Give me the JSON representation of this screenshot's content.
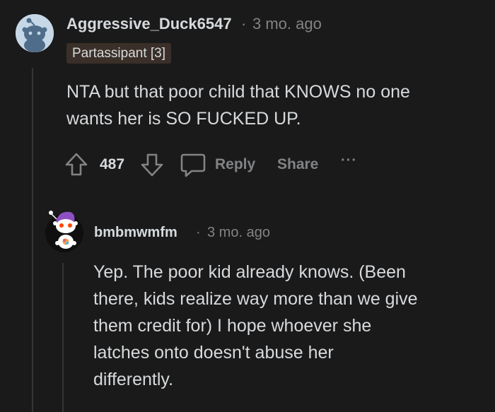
{
  "comment": {
    "username": "Aggressive_Duck6547",
    "separator": "·",
    "timestamp": "3 mo. ago",
    "flair": "Partassipant [3]",
    "body_lines": [
      "NTA but that poor child that KNOWS no one",
      "wants her is SO FUCKED UP."
    ],
    "votes": "487",
    "reply_label": "Reply",
    "share_label": "Share",
    "more_label": "···",
    "icons": [
      "upvote-arrow-icon",
      "downvote-arrow-icon",
      "comment-bubble-icon",
      "more-options-icon"
    ],
    "accent_color": "#818384"
  },
  "reply": {
    "username": "bmbmwmfm",
    "separator": "·",
    "timestamp": "3 mo. ago",
    "body_lines": [
      "Yep. The poor kid already knows. (Been",
      "there, kids realize way more than we give",
      "them credit for) I hope whoever she",
      "latches onto doesn't abuse her",
      "differently."
    ]
  },
  "colors": {
    "background": "#1a1a1b",
    "text": "#d7dadc",
    "muted": "#818384",
    "flair_bg": "#3a2f29",
    "thread_line": "#343536"
  }
}
